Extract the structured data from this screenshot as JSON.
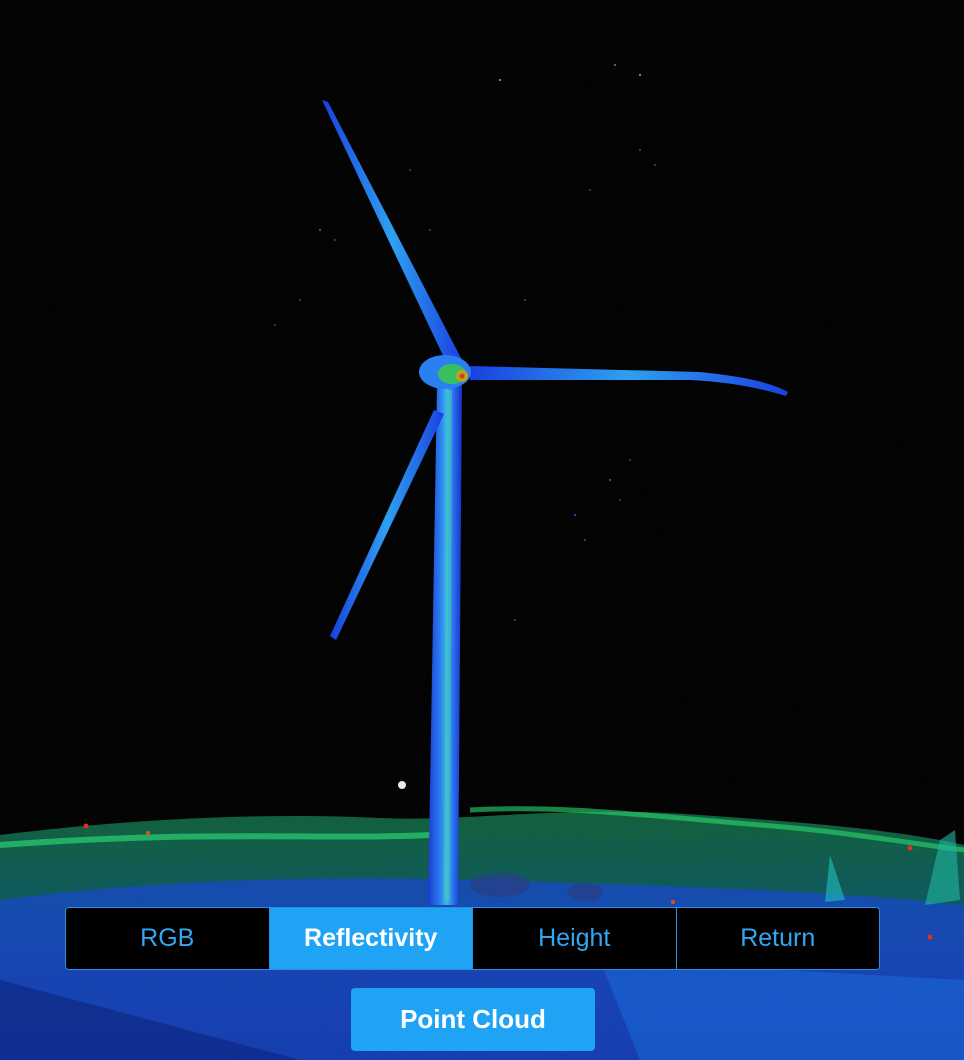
{
  "viewer": {
    "background": "#030303",
    "scene": "wind-turbine-point-cloud",
    "color_mode": "Reflectivity"
  },
  "mode_bar": {
    "buttons": [
      {
        "label": "RGB",
        "active": false
      },
      {
        "label": "Reflectivity",
        "active": true
      },
      {
        "label": "Height",
        "active": false
      },
      {
        "label": "Return",
        "active": false
      }
    ]
  },
  "point_cloud_button": {
    "label": "Point Cloud"
  },
  "colors": {
    "accent": "#1fa3f5",
    "inactive_text": "#33a6f2",
    "active_text": "#ffffff"
  }
}
